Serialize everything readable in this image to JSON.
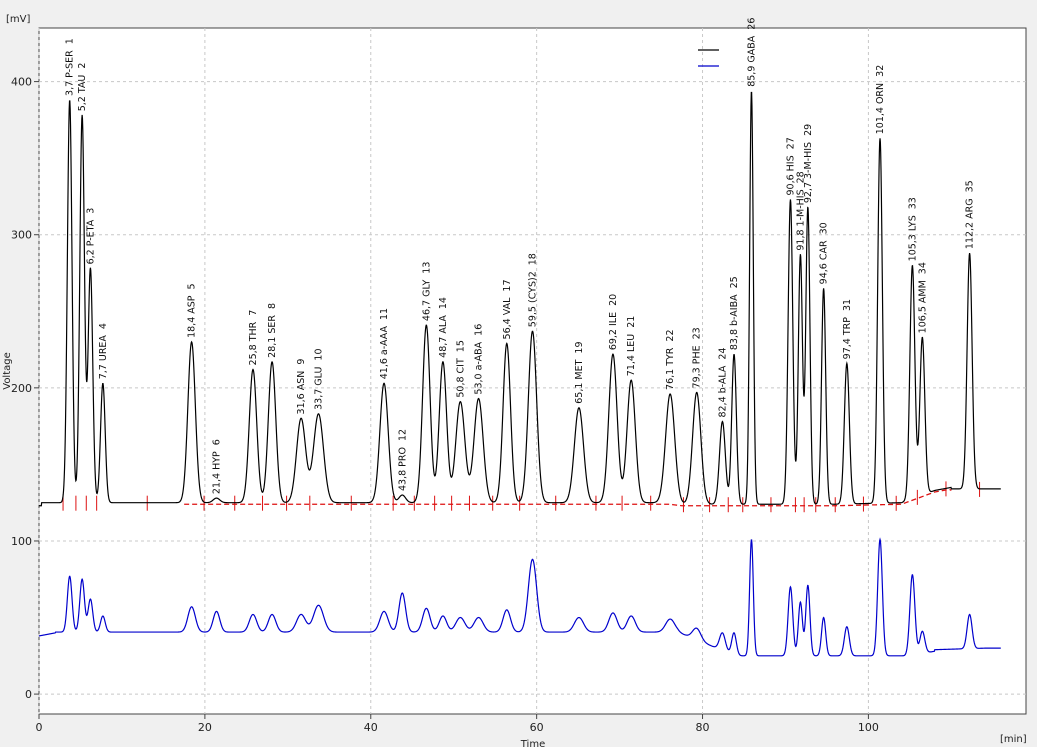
{
  "chart_data": {
    "type": "line",
    "title": "",
    "xlabel": "Time",
    "ylabel": "Voltage",
    "x_unit": "[min]",
    "y_unit": "[mV]",
    "xlim": [
      0,
      119
    ],
    "ylim": [
      -13,
      435
    ],
    "x_ticks": [
      0,
      20,
      40,
      60,
      80,
      100
    ],
    "y_ticks": [
      0,
      100,
      200,
      300,
      400
    ],
    "grid": true,
    "legend": {
      "position": "top-right"
    },
    "series_colors": {
      "black": "#000000",
      "blue": "#0000cc",
      "baseline": "#dd1111"
    },
    "peaks": [
      {
        "label": "3,7 P-SER",
        "num": "1",
        "t": 3.7,
        "h": 388,
        "w": 0.28
      },
      {
        "label": "5,2 TAU",
        "num": "2",
        "t": 5.2,
        "h": 378,
        "w": 0.28
      },
      {
        "label": "6,2 P-ETA",
        "num": "3",
        "t": 6.2,
        "h": 278,
        "w": 0.28
      },
      {
        "label": "7,7 UREA",
        "num": "4",
        "t": 7.7,
        "h": 203,
        "w": 0.28
      },
      {
        "label": "18,4 ASP",
        "num": "5",
        "t": 18.4,
        "h": 230,
        "w": 0.45
      },
      {
        "label": "21,4 HYP",
        "num": "6",
        "t": 21.4,
        "h": 128,
        "w": 0.4
      },
      {
        "label": "25,8 THR",
        "num": "7",
        "t": 25.8,
        "h": 212,
        "w": 0.45
      },
      {
        "label": "28,1 SER",
        "num": "8",
        "t": 28.1,
        "h": 217,
        "w": 0.45
      },
      {
        "label": "31,6 ASN",
        "num": "9",
        "t": 31.6,
        "h": 180,
        "w": 0.55
      },
      {
        "label": "33,7 GLU",
        "num": "10",
        "t": 33.7,
        "h": 183,
        "w": 0.6
      },
      {
        "label": "41,6 a-AAA",
        "num": "11",
        "t": 41.6,
        "h": 203,
        "w": 0.5
      },
      {
        "label": "43,8 PRO",
        "num": "12",
        "t": 43.8,
        "h": 130,
        "w": 0.4
      },
      {
        "label": "46,7 GLY",
        "num": "13",
        "t": 46.7,
        "h": 241,
        "w": 0.45
      },
      {
        "label": "48,7 ALA",
        "num": "14",
        "t": 48.7,
        "h": 217,
        "w": 0.45
      },
      {
        "label": "50,8 CIT",
        "num": "15",
        "t": 50.8,
        "h": 191,
        "w": 0.55
      },
      {
        "label": "53,0 a-ABA",
        "num": "16",
        "t": 53.0,
        "h": 193,
        "w": 0.55
      },
      {
        "label": "56,4 VAL",
        "num": "17",
        "t": 56.4,
        "h": 229,
        "w": 0.45
      },
      {
        "label": "59,5 (CYS)2",
        "num": "18",
        "t": 59.5,
        "h": 237,
        "w": 0.5
      },
      {
        "label": "65,1 MET",
        "num": "19",
        "t": 65.1,
        "h": 187,
        "w": 0.55
      },
      {
        "label": "69,2 ILE",
        "num": "20",
        "t": 69.2,
        "h": 222,
        "w": 0.5
      },
      {
        "label": "71,4 LEU",
        "num": "21",
        "t": 71.4,
        "h": 205,
        "w": 0.5
      },
      {
        "label": "76,1 TYR",
        "num": "22",
        "t": 76.1,
        "h": 196,
        "w": 0.55
      },
      {
        "label": "79,3 PHE",
        "num": "23",
        "t": 79.3,
        "h": 197,
        "w": 0.5
      },
      {
        "label": "82,4 b-ALA",
        "num": "24",
        "t": 82.4,
        "h": 178,
        "w": 0.35
      },
      {
        "label": "83,8 b-AIBA",
        "num": "25",
        "t": 83.8,
        "h": 222,
        "w": 0.28
      },
      {
        "label": "85,9 GABA",
        "num": "26",
        "t": 85.9,
        "h": 394,
        "w": 0.22
      },
      {
        "label": "90,6 HIS",
        "num": "27",
        "t": 90.6,
        "h": 323,
        "w": 0.28
      },
      {
        "label": "91,8 1-M-HIS",
        "num": "28",
        "t": 91.8,
        "h": 287,
        "w": 0.25
      },
      {
        "label": "92,7 3-M-HIS",
        "num": "29",
        "t": 92.7,
        "h": 318,
        "w": 0.25
      },
      {
        "label": "94,6 CAR",
        "num": "30",
        "t": 94.6,
        "h": 265,
        "w": 0.25
      },
      {
        "label": "97,4 TRP",
        "num": "31",
        "t": 97.4,
        "h": 216,
        "w": 0.3
      },
      {
        "label": "101,4 ORN",
        "num": "32",
        "t": 101.4,
        "h": 363,
        "w": 0.28
      },
      {
        "label": "105,3 LYS",
        "num": "33",
        "t": 105.3,
        "h": 280,
        "w": 0.3
      },
      {
        "label": "106,5 AMM",
        "num": "34",
        "t": 106.5,
        "h": 233,
        "w": 0.3
      },
      {
        "label": "112,2 ARG",
        "num": "35",
        "t": 112.2,
        "h": 288,
        "w": 0.3
      }
    ],
    "blue_peaks": [
      {
        "t": 3.7,
        "h": 77
      },
      {
        "t": 5.2,
        "h": 75
      },
      {
        "t": 6.2,
        "h": 62
      },
      {
        "t": 7.7,
        "h": 51
      },
      {
        "t": 18.4,
        "h": 57
      },
      {
        "t": 21.4,
        "h": 54
      },
      {
        "t": 25.8,
        "h": 52
      },
      {
        "t": 28.1,
        "h": 52
      },
      {
        "t": 31.6,
        "h": 52
      },
      {
        "t": 33.7,
        "h": 58
      },
      {
        "t": 41.6,
        "h": 54
      },
      {
        "t": 43.8,
        "h": 66
      },
      {
        "t": 46.7,
        "h": 56
      },
      {
        "t": 48.7,
        "h": 51
      },
      {
        "t": 50.8,
        "h": 50
      },
      {
        "t": 53.0,
        "h": 50
      },
      {
        "t": 56.4,
        "h": 55
      },
      {
        "t": 59.5,
        "h": 88
      },
      {
        "t": 65.1,
        "h": 50
      },
      {
        "t": 69.2,
        "h": 53
      },
      {
        "t": 71.4,
        "h": 51
      },
      {
        "t": 76.1,
        "h": 49
      },
      {
        "t": 79.3,
        "h": 43
      },
      {
        "t": 82.4,
        "h": 40
      },
      {
        "t": 83.8,
        "h": 40
      },
      {
        "t": 85.9,
        "h": 101
      },
      {
        "t": 90.6,
        "h": 70
      },
      {
        "t": 91.8,
        "h": 60
      },
      {
        "t": 92.7,
        "h": 71
      },
      {
        "t": 94.6,
        "h": 50
      },
      {
        "t": 97.4,
        "h": 44
      },
      {
        "t": 101.4,
        "h": 101
      },
      {
        "t": 105.3,
        "h": 78
      },
      {
        "t": 106.5,
        "h": 41
      },
      {
        "t": 112.2,
        "h": 52
      }
    ]
  }
}
